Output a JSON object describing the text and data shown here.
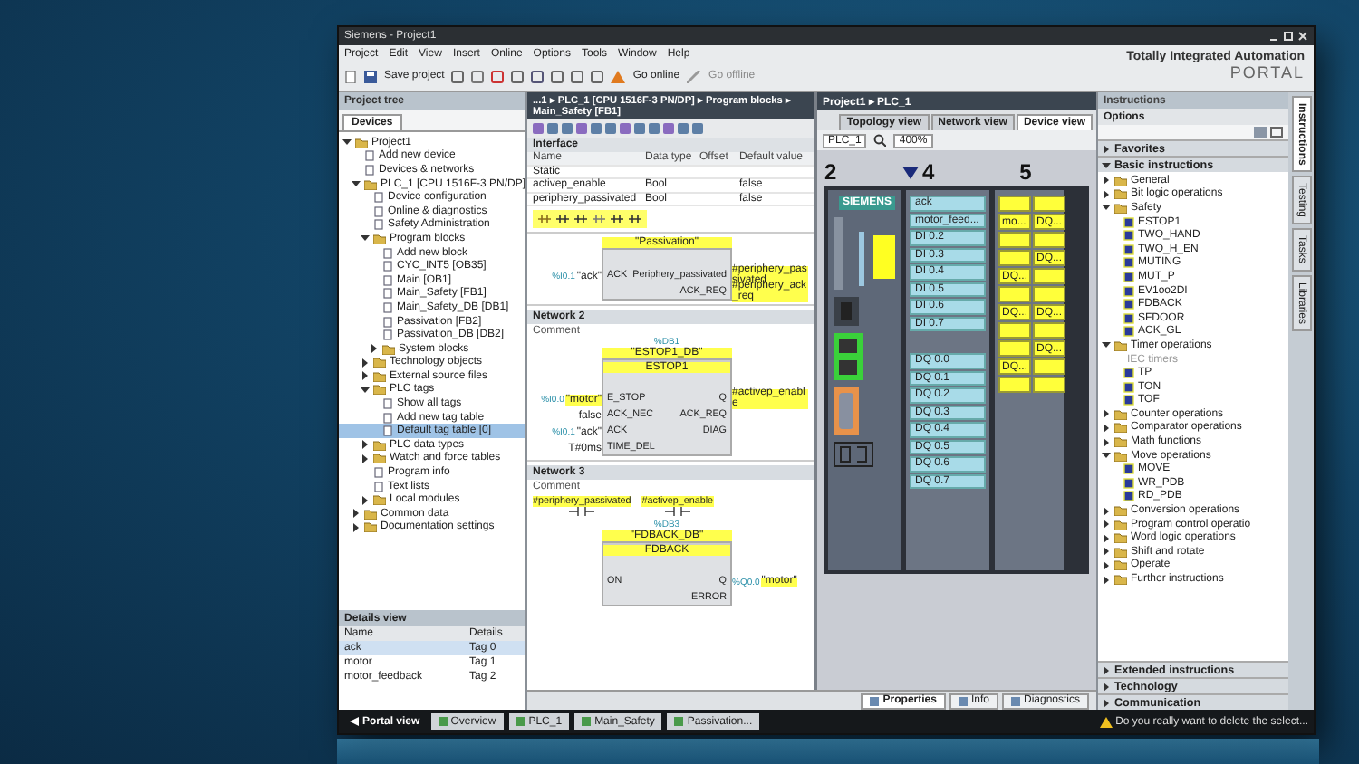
{
  "window": {
    "title": "Siemens - Project1"
  },
  "menu": [
    "Project",
    "Edit",
    "View",
    "Insert",
    "Online",
    "Options",
    "Tools",
    "Window",
    "Help"
  ],
  "toolbar": {
    "save": "Save project",
    "go_online": "Go online",
    "go_offline": "Go offline"
  },
  "brand": {
    "line1": "Totally Integrated Automation",
    "line2": "PORTAL"
  },
  "project_tree": {
    "title": "Project tree",
    "tab": "Devices",
    "items": [
      {
        "label": "Project1",
        "expanded": true,
        "children": [
          {
            "label": "Add new device"
          },
          {
            "label": "Devices & networks"
          },
          {
            "label": "PLC_1 [CPU 1516F-3 PN/DP]",
            "expanded": true,
            "children": [
              {
                "label": "Device configuration"
              },
              {
                "label": "Online & diagnostics"
              },
              {
                "label": "Safety Administration"
              },
              {
                "label": "Program blocks",
                "expanded": true,
                "children": [
                  {
                    "label": "Add new block"
                  },
                  {
                    "label": "CYC_INT5 [OB35]"
                  },
                  {
                    "label": "Main [OB1]"
                  },
                  {
                    "label": "Main_Safety [FB1]"
                  },
                  {
                    "label": "Main_Safety_DB [DB1]"
                  },
                  {
                    "label": "Passivation [FB2]"
                  },
                  {
                    "label": "Passivation_DB [DB2]"
                  },
                  {
                    "label": "System blocks",
                    "expanded": false
                  }
                ]
              },
              {
                "label": "Technology objects",
                "expanded": false
              },
              {
                "label": "External source files",
                "expanded": false
              },
              {
                "label": "PLC tags",
                "expanded": true,
                "children": [
                  {
                    "label": "Show all tags"
                  },
                  {
                    "label": "Add new tag table"
                  },
                  {
                    "label": "Default tag table [0]",
                    "selected": true
                  }
                ]
              },
              {
                "label": "PLC data types",
                "expanded": false
              },
              {
                "label": "Watch and force tables",
                "expanded": false
              },
              {
                "label": "Program info"
              },
              {
                "label": "Text lists"
              },
              {
                "label": "Local modules",
                "expanded": false
              }
            ]
          },
          {
            "label": "Common data",
            "expanded": false
          },
          {
            "label": "Documentation settings",
            "expanded": false
          }
        ]
      }
    ]
  },
  "details_view": {
    "title": "Details view",
    "columns": [
      "Name",
      "Details"
    ],
    "rows": [
      {
        "name": "ack",
        "details": "Tag 0",
        "selected": true
      },
      {
        "name": "motor",
        "details": "Tag 1",
        "selected": false
      },
      {
        "name": "motor_feedback",
        "details": "Tag 2",
        "selected": false
      }
    ]
  },
  "editor": {
    "breadcrumb": "...1 ▸ PLC_1 [CPU 1516F-3 PN/DP] ▸ Program blocks ▸ Main_Safety [FB1]",
    "interface": {
      "title": "Interface",
      "columns": [
        "Name",
        "Data type",
        "Offset",
        "Default value"
      ],
      "rows": [
        {
          "name": "Static",
          "type": "",
          "offset": "",
          "default": ""
        },
        {
          "name": "activep_enable",
          "type": "Bool",
          "offset": "",
          "default": "false"
        },
        {
          "name": "periphery_passivated",
          "type": "Bool",
          "offset": "",
          "default": "false"
        }
      ]
    },
    "networks": [
      {
        "instance": "\"Passivation\"",
        "inputs": [
          {
            "addr": "%I0.1",
            "tag": "\"ack\"",
            "pin": "ACK",
            "highlighted": false
          }
        ],
        "outputs": [
          {
            "pin": "Periphery_passivated",
            "tag": "#periphery_passivated",
            "highlighted": true
          },
          {
            "pin": "ACK_REQ",
            "tag": "#periphery_ack_req",
            "highlighted": true
          }
        ]
      },
      {
        "title": "Network 2",
        "comment": "Comment",
        "db_addr": "%DB1",
        "instance": "\"ESTOP1_DB\"",
        "type": "ESTOP1",
        "inputs": [
          {
            "addr": "%I0.0",
            "tag": "\"motor\"",
            "pin": "E_STOP",
            "highlighted": true
          },
          {
            "tag": "false",
            "pin": "ACK_NEC",
            "highlighted": false
          },
          {
            "addr": "%I0.1",
            "tag": "\"ack\"",
            "pin": "ACK",
            "highlighted": false
          },
          {
            "tag": "T#0ms",
            "pin": "TIME_DEL",
            "highlighted": false
          }
        ],
        "outputs": [
          {
            "pin": "Q",
            "tag": "#activep_enable",
            "highlighted": true
          },
          {
            "pin": "ACK_REQ"
          },
          {
            "pin": "DIAG"
          }
        ]
      },
      {
        "title": "Network 3",
        "comment": "Comment",
        "contacts": [
          {
            "tag": "#periphery_passivated"
          },
          {
            "tag": "#activep_enable"
          }
        ],
        "db_addr": "%DB3",
        "instance": "\"FDBACK_DB\"",
        "type": "FDBACK",
        "inputs": [
          {
            "pin": "ON"
          }
        ],
        "outputs": [
          {
            "pin": "Q",
            "addr": "%Q0.0",
            "tag": "\"motor\"",
            "highlighted": true
          },
          {
            "pin": "ERROR"
          }
        ]
      }
    ]
  },
  "device_view": {
    "breadcrumb": "Project1 ▸ PLC_1",
    "tabs": [
      {
        "label": "Topology view",
        "selected": false
      },
      {
        "label": "Network view",
        "selected": false
      },
      {
        "label": "Device view",
        "selected": true
      }
    ],
    "device": "PLC_1",
    "zoom": "400%",
    "cpu": {
      "slot": "2",
      "logo": "SIEMENS"
    },
    "di_module": {
      "slot": "4",
      "inputs": [
        "ack",
        "motor_feed...",
        "DI 0.2",
        "DI 0.3",
        "DI 0.4",
        "DI 0.5",
        "DI 0.6",
        "DI 0.7"
      ],
      "outputs": [
        "DQ 0.0",
        "DQ 0.1",
        "DQ 0.2",
        "DQ 0.3",
        "DQ 0.4",
        "DQ 0.5",
        "DQ 0.6",
        "DQ 0.7"
      ]
    },
    "f_module": {
      "slot": "5",
      "fields": [
        "mo...",
        "DQ...",
        "DQ...",
        "DQ...",
        "DQ...",
        "DQ...",
        "DQ...",
        "DQ..."
      ]
    }
  },
  "inspector_tabs": [
    {
      "label": "Properties",
      "selected": true
    },
    {
      "label": "Info",
      "selected": false
    },
    {
      "label": "Diagnostics",
      "selected": false
    }
  ],
  "instructions": {
    "title": "Instructions",
    "options": "Options",
    "sections": [
      {
        "label": "Favorites",
        "expanded": false
      },
      {
        "label": "Basic instructions",
        "expanded": true
      }
    ],
    "items": [
      {
        "label": "General",
        "expanded": false
      },
      {
        "label": "Bit logic operations",
        "expanded": false
      },
      {
        "label": "Safety",
        "expanded": true,
        "children": [
          {
            "label": "ESTOP1"
          },
          {
            "label": "TWO_HAND"
          },
          {
            "label": "TWO_H_EN"
          },
          {
            "label": "MUTING"
          },
          {
            "label": "MUT_P"
          },
          {
            "label": "EV1oo2DI"
          },
          {
            "label": "FDBACK"
          },
          {
            "label": "SFDOOR"
          },
          {
            "label": "ACK_GL"
          }
        ]
      },
      {
        "label": "Timer operations",
        "expanded": true,
        "children": [
          {
            "label": "IEC timers",
            "kind": "group"
          },
          {
            "label": "TP"
          },
          {
            "label": "TON"
          },
          {
            "label": "TOF"
          }
        ]
      },
      {
        "label": "Counter operations",
        "expanded": false
      },
      {
        "label": "Comparator operations",
        "expanded": false
      },
      {
        "label": "Math functions",
        "expanded": false
      },
      {
        "label": "Move operations",
        "expanded": true,
        "children": [
          {
            "label": "MOVE"
          },
          {
            "label": "WR_PDB"
          },
          {
            "label": "RD_PDB"
          }
        ]
      },
      {
        "label": "Conversion operations",
        "expanded": false
      },
      {
        "label": "Program control operatio",
        "expanded": false
      },
      {
        "label": "Word logic operations",
        "expanded": false
      },
      {
        "label": "Shift and rotate",
        "expanded": false
      },
      {
        "label": "Operate",
        "expanded": false
      },
      {
        "label": "Further instructions",
        "expanded": false
      }
    ],
    "bottom_sections": [
      {
        "label": "Extended instructions",
        "expanded": false
      },
      {
        "label": "Technology",
        "expanded": false
      },
      {
        "label": "Communication",
        "expanded": false
      }
    ]
  },
  "side_tabs": [
    {
      "label": "Instructions",
      "selected": true
    },
    {
      "label": "Testing",
      "selected": false
    },
    {
      "label": "Tasks",
      "selected": false
    },
    {
      "label": "Libraries",
      "selected": false
    }
  ],
  "taskbar": {
    "portal": "Portal view",
    "items": [
      "Overview",
      "PLC_1",
      "Main_Safety",
      "Passivation..."
    ],
    "status": "Do you really want to delete the select..."
  }
}
